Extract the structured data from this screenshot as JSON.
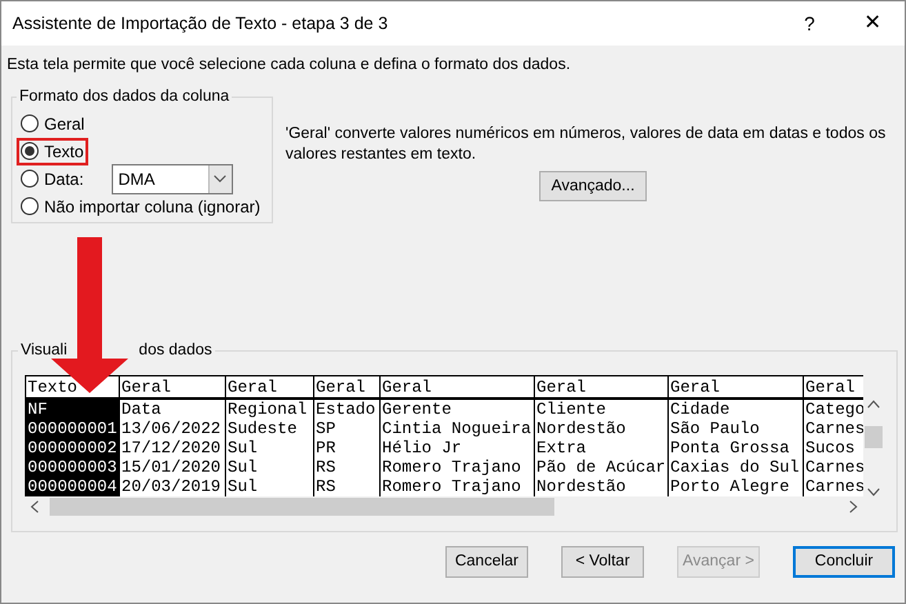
{
  "window": {
    "title": "Assistente de Importação de Texto - etapa 3 de 3",
    "help": "?",
    "close": "✕"
  },
  "instruction": "Esta tela permite que você selecione cada coluna e defina o formato dos dados.",
  "format_group": {
    "legend": "Formato dos dados da coluna",
    "options": [
      {
        "kind": "radio",
        "label": "Geral",
        "selected": false,
        "highlighted": false
      },
      {
        "kind": "radio",
        "label": "Texto",
        "selected": true,
        "highlighted": true
      },
      {
        "kind": "radio-select",
        "label": "Data:",
        "selected": false,
        "highlighted": false,
        "select_value": "DMA"
      },
      {
        "kind": "radio",
        "label": "Não importar coluna (ignorar)",
        "selected": false,
        "highlighted": false
      }
    ]
  },
  "description": "'Geral' converte valores numéricos em números, valores de data em datas e todos os valores restantes em texto.",
  "advanced_button": "Avançado...",
  "preview": {
    "legend_parts": [
      "Visuali",
      "dos dados"
    ],
    "columns": [
      {
        "header": "Texto",
        "selected": true
      },
      {
        "header": "Geral",
        "selected": false
      },
      {
        "header": "Geral",
        "selected": false
      },
      {
        "header": "Geral",
        "selected": false
      },
      {
        "header": "Geral",
        "selected": false
      },
      {
        "header": "Geral",
        "selected": false
      },
      {
        "header": "Geral",
        "selected": false
      },
      {
        "header": "Geral",
        "selected": false
      }
    ],
    "rows": [
      [
        "NF",
        "Data",
        "Regional",
        "Estado",
        "Gerente",
        "Cliente",
        "Cidade",
        "Catego"
      ],
      [
        "000000001",
        "13/06/2022",
        "Sudeste",
        "SP",
        "Cintia Nogueira",
        "Nordestão",
        "São Paulo",
        "Carnes"
      ],
      [
        "000000002",
        "17/12/2020",
        "Sul",
        "PR",
        "Hélio Jr",
        "Extra",
        "Ponta Grossa",
        "Sucos"
      ],
      [
        "000000003",
        "15/01/2020",
        "Sul",
        "RS",
        "Romero Trajano",
        "Pão de Acúcar",
        "Caxias do Sul",
        "Carnes"
      ],
      [
        "000000004",
        "20/03/2019",
        "Sul",
        "RS",
        "Romero Trajano",
        "Nordestão",
        "Porto Alegre",
        "Carnes"
      ]
    ]
  },
  "buttons": [
    {
      "label": "Cancelar",
      "disabled": false,
      "default": false
    },
    {
      "label": "< Voltar",
      "disabled": false,
      "default": false
    },
    {
      "label": "Avançar >",
      "disabled": true,
      "default": false
    },
    {
      "label": "Concluir",
      "disabled": false,
      "default": true
    }
  ]
}
